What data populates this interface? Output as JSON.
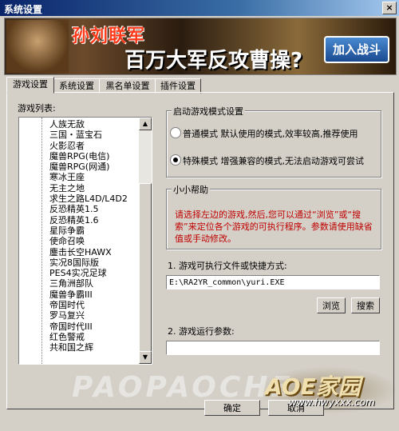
{
  "window": {
    "title": "系统设置",
    "close_glyph": "×"
  },
  "banner": {
    "line1": "孙刘联军",
    "line2": "百万大军反攻曹操?",
    "join_button": "加入战斗"
  },
  "tabs": [
    {
      "label": "游戏设置",
      "active": true
    },
    {
      "label": "系统设置",
      "active": false
    },
    {
      "label": "黑名单设置",
      "active": false
    },
    {
      "label": "插件设置",
      "active": false
    }
  ],
  "game_list": {
    "label": "游戏列表:",
    "items": [
      "人族无敌",
      "三国・蓝宝石",
      "火影忍者",
      "魔兽RPG(电信)",
      "魔兽RPG(网通)",
      "寒冰王座",
      "无主之地",
      "求生之路L4D/L4D2",
      "反恐精英1.5",
      "反恐精英1.6",
      "星际争霸",
      "使命召唤",
      "鏖击长空HAWX",
      "实况8国际版",
      "PES4实况足球",
      "三角洲部队",
      "魔兽争霸III",
      "帝国时代",
      "罗马复兴",
      "帝国时代III",
      "红色警戒",
      "共和国之辉"
    ]
  },
  "launch_mode": {
    "title": "启动游戏模式设置",
    "options": [
      {
        "label": "普通模式 默认使用的模式,效率较高,推荐使用",
        "selected": false
      },
      {
        "label": "特殊模式 增强兼容的模式,无法启动游戏可尝试",
        "selected": true
      }
    ]
  },
  "help": {
    "title": "小小帮助",
    "text": "请选择左边的游戏,然后,您可以通过“浏览”或“搜索”来定位各个游戏的可执行程序。参数请使用缺省值或手动修改。"
  },
  "exe": {
    "label": "1. 游戏可执行文件或快捷方式:",
    "value": "E:\\RA2YR_common\\yuri.EXE"
  },
  "buttons": {
    "browse": "浏览",
    "search": "搜索",
    "ok": "确定",
    "cancel": "取消"
  },
  "params": {
    "label": "2. 游戏运行参数:",
    "value": ""
  },
  "watermark": {
    "left": "PAOPAOCHE",
    "brand": "AOE家园",
    "url": "www.hwyxxx.com"
  }
}
